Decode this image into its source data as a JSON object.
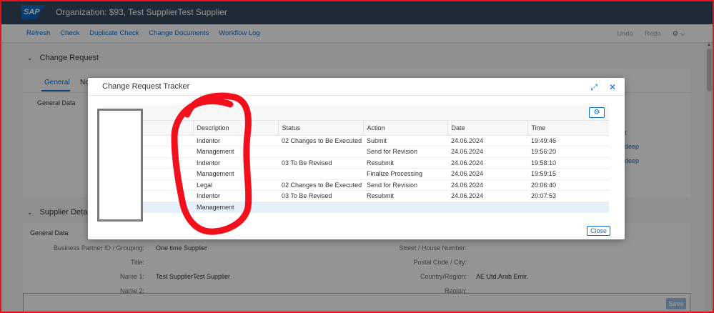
{
  "shell": {
    "logo_text": "SAP",
    "title": "Organization: $93, Test SupplierTest Supplier"
  },
  "toolbar": {
    "buttons": [
      "Refresh",
      "Check",
      "Duplicate Check",
      "Change Documents",
      "Workflow Log"
    ],
    "undo": "Undo",
    "redo": "Redo",
    "settings_icon": "⚙",
    "settings_chevron": "⌵"
  },
  "change_request": {
    "title": "Change Request",
    "tab_general": "General",
    "tab_partial": "No",
    "group_label": "General Data",
    "links": [
      "t",
      "deep",
      "deep"
    ]
  },
  "supplier": {
    "title": "Supplier Detail",
    "group_label": "General Data",
    "left_fields": [
      {
        "label": "Business Partner ID / Grouping:",
        "value": "One time Supplier"
      },
      {
        "label": "Title:",
        "value": ""
      },
      {
        "label": "Name 1:",
        "value": "Test SupplierTest Supplier"
      },
      {
        "label": "Name 2:",
        "value": ""
      }
    ],
    "right_fields": [
      {
        "label": "Street / House Number:",
        "value": ""
      },
      {
        "label": "Postal Code / City:",
        "value": ""
      },
      {
        "label": "Country/Region:",
        "value": "AE Utd.Arab Emir."
      },
      {
        "label": "Region:",
        "value": ""
      }
    ]
  },
  "footer": {
    "save_label": "Save"
  },
  "dialog": {
    "title": "Change Request Tracker",
    "expand_icon": "⤢",
    "close_icon": "✕",
    "settings_icon": "⚙",
    "close_label": "Close",
    "columns": [
      "Description",
      "Status",
      "Action",
      "Date",
      "Time"
    ],
    "rows": [
      [
        "Indentor",
        "02 Changes to Be Executed",
        "Submit",
        "24.06.2024",
        "19:49:46"
      ],
      [
        "Management",
        "",
        "Send for Revision",
        "24.06.2024",
        "19:56:20"
      ],
      [
        "Indentor",
        "03 To Be Revised",
        "Resubmit",
        "24.06.2024",
        "19:58:10"
      ],
      [
        "Management",
        "",
        "Finalize Processing",
        "24.06.2024",
        "19:59:15"
      ],
      [
        "Legal",
        "02 Changes to Be Executed",
        "Send for Revision",
        "24.06.2024",
        "20:06:40"
      ],
      [
        "Indentor",
        "03 To Be Revised",
        "Resubmit",
        "24.06.2024",
        "20:07:53"
      ],
      [
        "Management",
        "",
        "",
        "",
        ""
      ]
    ],
    "selected_row": 6
  },
  "annotation_color": "#f2101c"
}
